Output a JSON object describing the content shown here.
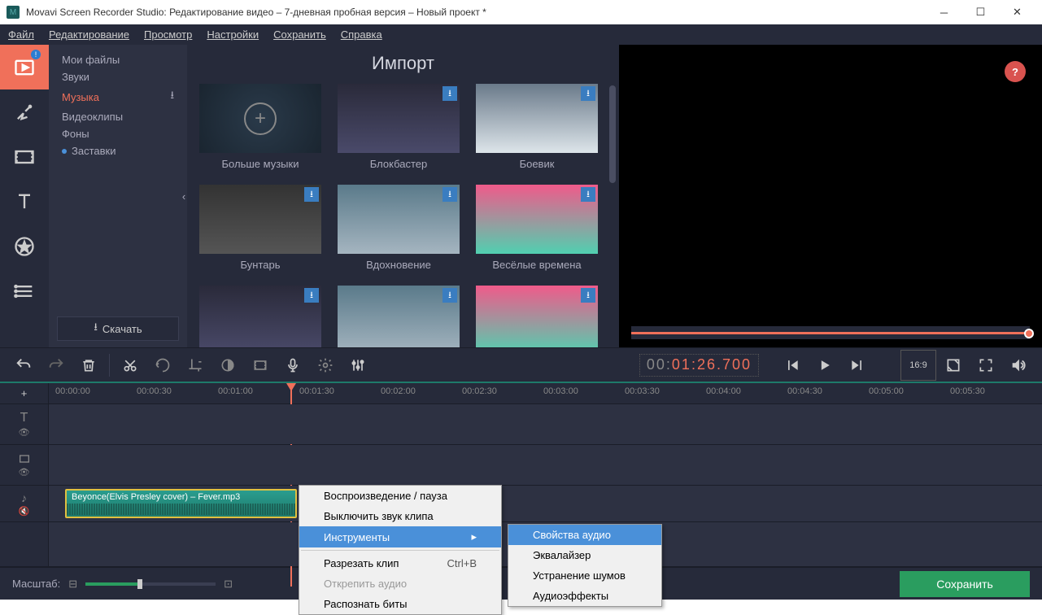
{
  "window": {
    "title": "Movavi Screen Recorder Studio: Редактирование видео – 7-дневная пробная версия – Новый проект *"
  },
  "menubar": [
    "Файл",
    "Редактирование",
    "Просмотр",
    "Настройки",
    "Сохранить",
    "Справка"
  ],
  "sidebar": {
    "items": [
      {
        "label": "Мои файлы"
      },
      {
        "label": "Звуки"
      },
      {
        "label": "Музыка",
        "active": true,
        "download": true
      },
      {
        "label": "Видеоклипы"
      },
      {
        "label": "Фоны"
      },
      {
        "label": "Заставки",
        "dot": true
      }
    ],
    "download_label": "Скачать"
  },
  "content": {
    "title": "Импорт",
    "cards": [
      {
        "label": "Больше музыки",
        "more": true
      },
      {
        "label": "Блокбастер"
      },
      {
        "label": "Боевик"
      },
      {
        "label": "Бунтарь"
      },
      {
        "label": "Вдохновение"
      },
      {
        "label": "Весёлые времена"
      }
    ]
  },
  "timecode": {
    "gray": "00:",
    "orange": "01:26.700"
  },
  "ruler": {
    "ticks": [
      "00:00:00",
      "00:00:30",
      "00:01:00",
      "00:01:30",
      "00:02:00",
      "00:02:30",
      "00:03:00",
      "00:03:30",
      "00:04:00",
      "00:04:30",
      "00:05:00",
      "00:05:30"
    ]
  },
  "clip": {
    "label": "Beyonce(Elvis Presley cover) – Fever.mp3"
  },
  "zoom": {
    "label": "Масштаб:"
  },
  "save": {
    "label": "Сохранить"
  },
  "context_menu": {
    "items": [
      {
        "label": "Воспроизведение / пауза"
      },
      {
        "label": "Выключить звук клипа"
      },
      {
        "label": "Инструменты",
        "submenu": true,
        "hover": true
      },
      {
        "sep": true
      },
      {
        "label": "Разрезать клип",
        "shortcut": "Ctrl+B"
      },
      {
        "label": "Открепить аудио",
        "disabled": true
      },
      {
        "label": "Распознать биты"
      }
    ],
    "submenu": [
      {
        "label": "Свойства аудио",
        "hover": true
      },
      {
        "label": "Эквалайзер"
      },
      {
        "label": "Устранение шумов"
      },
      {
        "label": "Аудиоэффекты"
      }
    ]
  }
}
